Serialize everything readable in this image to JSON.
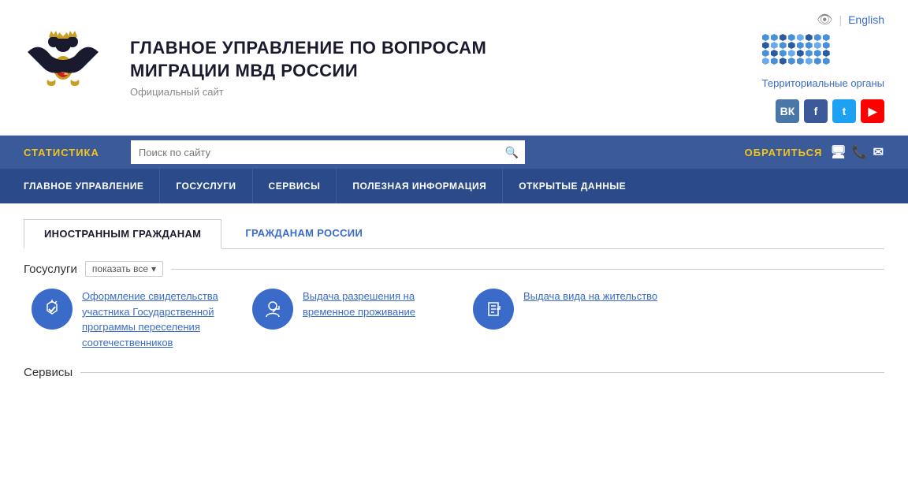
{
  "header": {
    "title": "ГЛАВНОЕ УПРАВЛЕНИЕ ПО ВОПРОСАМ\nМИГРАЦИИ МВД РОССИИ",
    "title_line1": "ГЛАВНОЕ УПРАВЛЕНИЕ ПО ВОПРОСАМ",
    "title_line2": "МИГРАЦИИ МВД РОССИИ",
    "subtitle": "Официальный сайт",
    "lang_label": "English",
    "territorial_link": "Территориальные органы"
  },
  "nav1": {
    "stat_label": "СТАТИСТИКА",
    "search_placeholder": "Поиск по сайту",
    "contact_label": "ОБРАТИТЬСЯ"
  },
  "nav2": {
    "items": [
      {
        "label": "ГЛАВНОЕ УПРАВЛЕНИЕ"
      },
      {
        "label": "ГОСУСЛУГИ"
      },
      {
        "label": "СЕРВИСЫ"
      },
      {
        "label": "ПОЛЕЗНАЯ ИНФОРМАЦИЯ"
      },
      {
        "label": "ОТКРЫТЫЕ ДАННЫЕ"
      }
    ]
  },
  "tabs": [
    {
      "label": "ИНОСТРАННЫМ ГРАЖДАНАМ",
      "active": true
    },
    {
      "label": "ГРАЖДАНАМ РОССИИ",
      "active": false
    }
  ],
  "gosuslugi": {
    "section_title": "Госуслуги",
    "show_all_label": "показать все",
    "services": [
      {
        "text": "Оформление свидетельства участника Государственной программы переселения соотечественников"
      },
      {
        "text": "Выдача разрешения на временное проживание"
      },
      {
        "text": "Выдача вида на жительство"
      }
    ]
  },
  "servisy": {
    "section_title": "Сервисы"
  },
  "social": {
    "vk": "ВК",
    "fb": "f",
    "tw": "t",
    "yt": "▶"
  }
}
